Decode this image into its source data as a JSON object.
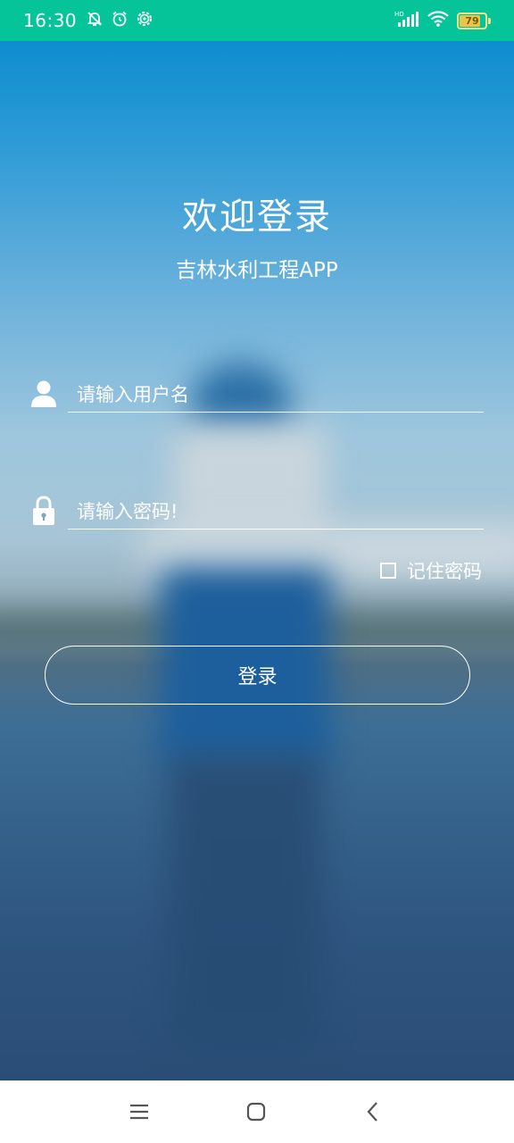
{
  "status_bar": {
    "time": "16:30",
    "battery_level": "79",
    "icons": [
      "mute-bell-icon",
      "alarm-clock-icon",
      "settings-gear-icon",
      "hd-signal-icon",
      "wifi-icon",
      "battery-icon"
    ]
  },
  "login": {
    "title": "欢迎登录",
    "subtitle": "吉林水利工程APP",
    "username_placeholder": "请输入用户名",
    "password_placeholder": "请输入密码!",
    "remember_label": "记住密码",
    "remember_checked": false,
    "login_button_label": "登录"
  },
  "nav_bar": {
    "buttons": [
      "menu-icon",
      "home-icon",
      "back-icon"
    ]
  },
  "colors": {
    "status_bar_bg": "#06c49a",
    "text": "#ffffff",
    "nav_bar_bg": "#ffffff",
    "nav_icon": "#555555"
  }
}
